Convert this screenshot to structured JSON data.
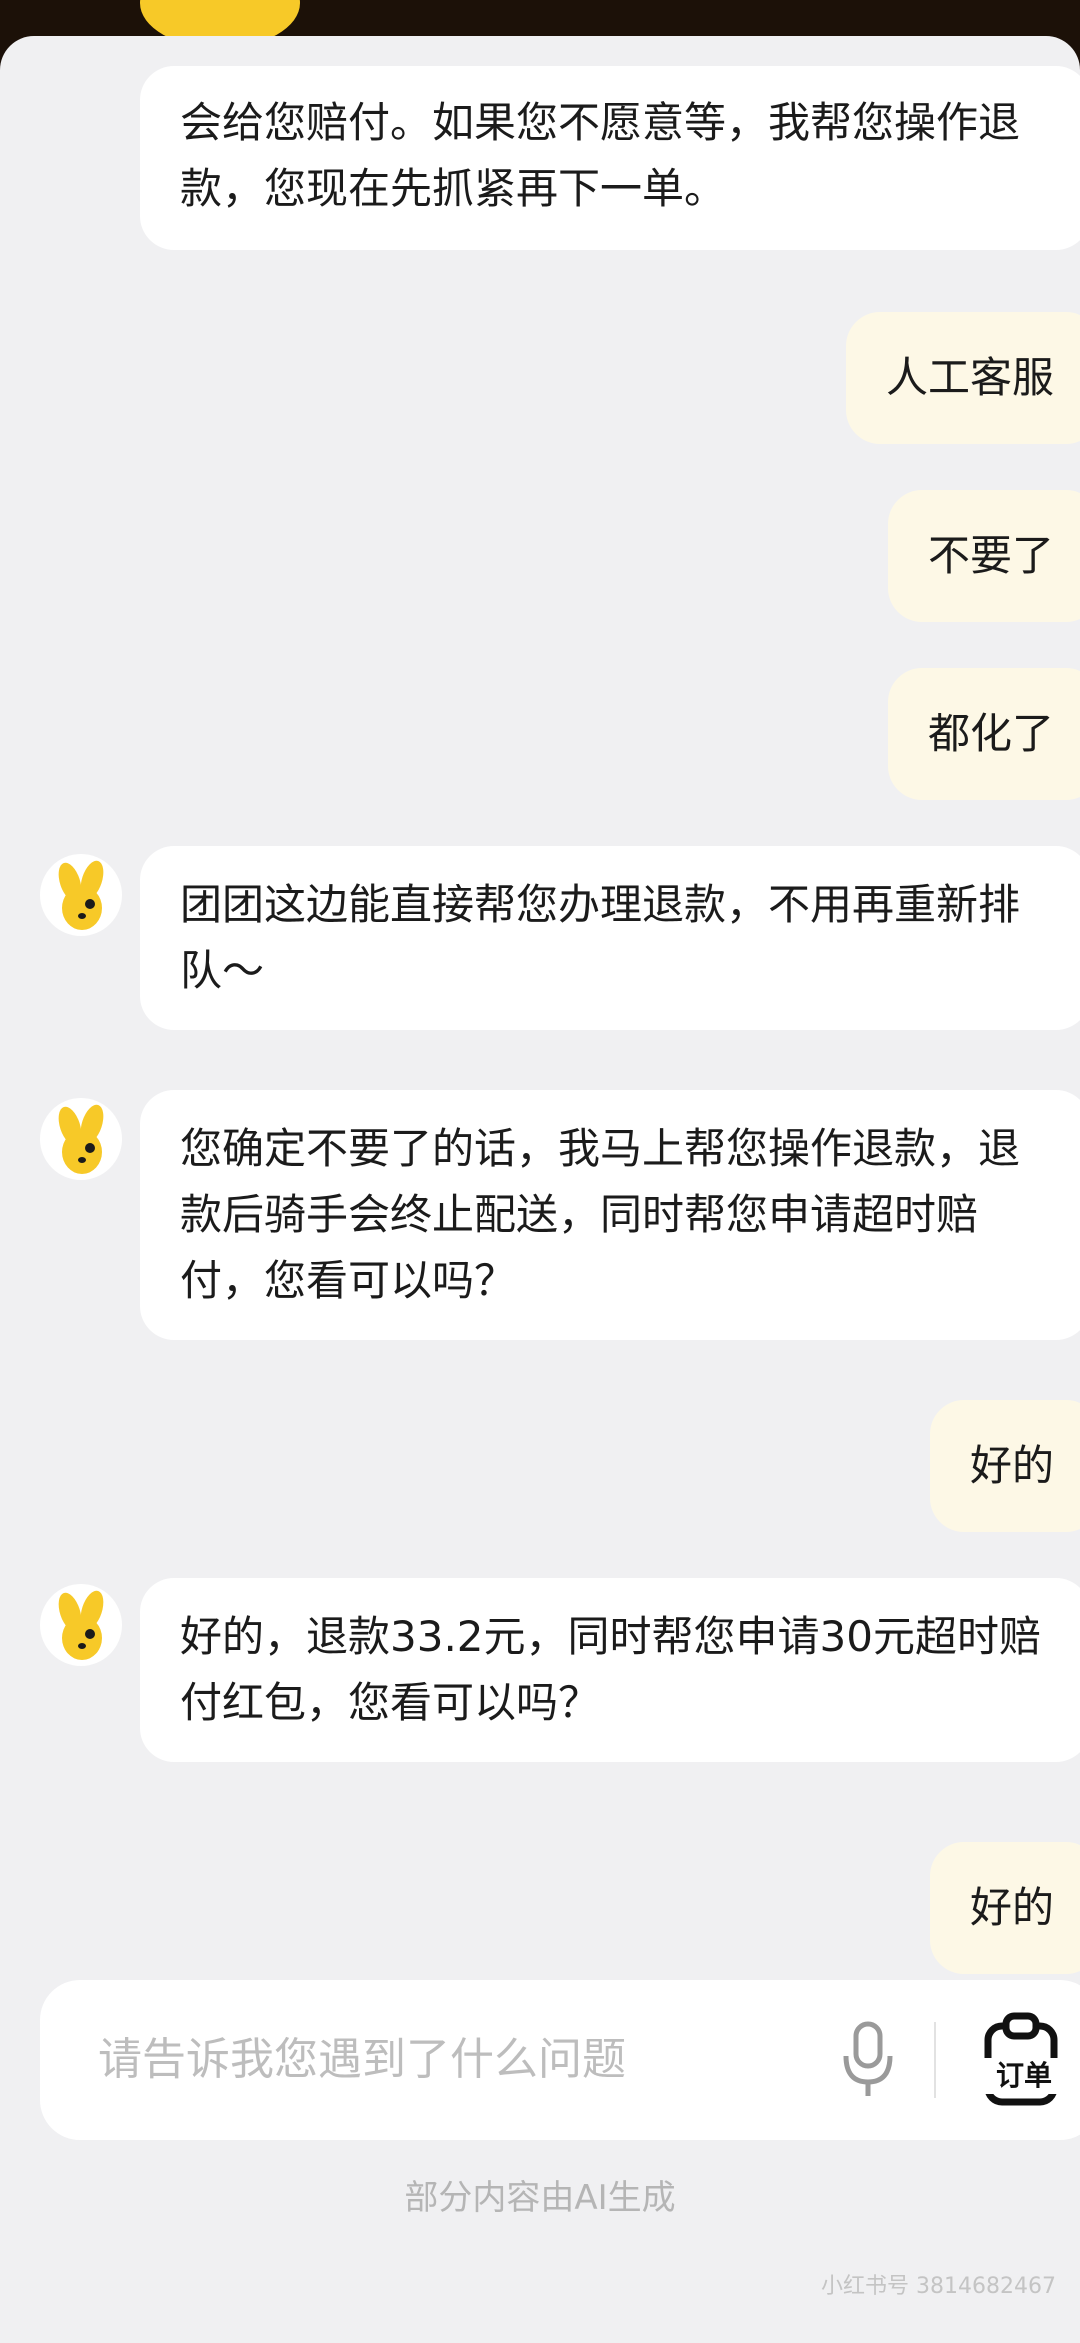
{
  "messages": {
    "bot_0": "会给您赔付。如果您不愿意等，我帮您操作退款，您现在先抓紧再下一单。",
    "user_1": "人工客服",
    "user_2": "不要了",
    "user_3": "都化了",
    "bot_4": "团团这边能直接帮您办理退款，不用再重新排队～",
    "bot_5": "您确定不要了的话，我马上帮您操作退款，退款后骑手会终止配送，同时帮您申请超时赔付，您看可以吗？",
    "user_6": "好的",
    "bot_7": "好的，退款33.2元，同时帮您申请30元超时赔付红包，您看可以吗？",
    "user_8": "好的"
  },
  "input": {
    "placeholder": "请告诉我您遇到了什么问题",
    "order_label": "订单",
    "mic_icon": "microphone-icon",
    "order_icon": "clipboard-order-icon"
  },
  "footer": {
    "ai_note": "部分内容由AI生成",
    "watermark": "小红书号 3814682467"
  },
  "colors": {
    "background": "#f0f0f2",
    "bot_bubble": "#ffffff",
    "user_bubble": "#fdf8e6",
    "mascot_yellow": "#f7c928"
  }
}
